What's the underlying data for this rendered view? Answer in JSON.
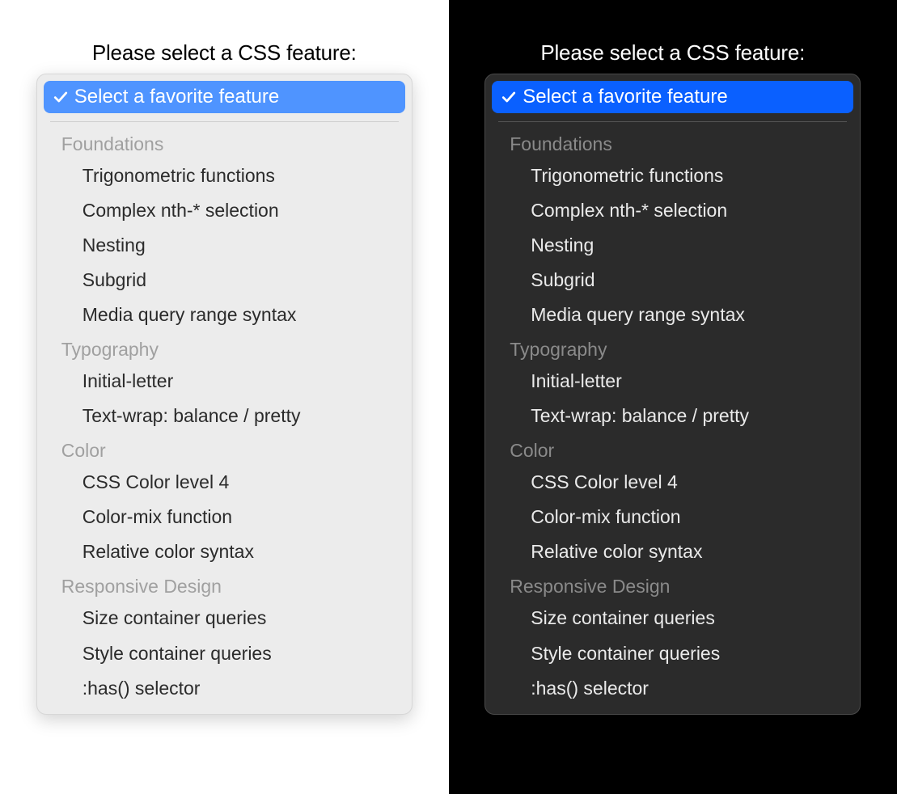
{
  "prompt_label": "Please select a CSS feature:",
  "selected_label": "Select a favorite feature",
  "colors": {
    "light_accent": "#4f94ff",
    "dark_accent": "#0a60ff"
  },
  "groups": [
    {
      "label": "Foundations",
      "options": [
        "Trigonometric functions",
        "Complex nth-* selection",
        "Nesting",
        "Subgrid",
        "Media query range syntax"
      ]
    },
    {
      "label": "Typography",
      "options": [
        "Initial-letter",
        "Text-wrap: balance / pretty"
      ]
    },
    {
      "label": "Color",
      "options": [
        "CSS Color level 4",
        "Color-mix function",
        "Relative color syntax"
      ]
    },
    {
      "label": "Responsive Design",
      "options": [
        "Size container queries",
        "Style container queries",
        ":has() selector"
      ]
    }
  ]
}
